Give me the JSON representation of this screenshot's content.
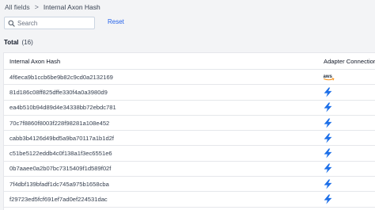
{
  "breadcrumb": {
    "root": "All fields",
    "separator": ">",
    "current": "Internal Axon Hash"
  },
  "toolbar": {
    "search_placeholder": "Search",
    "reset_label": "Reset"
  },
  "total": {
    "label": "Total",
    "count": "(16)"
  },
  "table": {
    "columns": [
      "Internal Axon Hash",
      "Adapter Connections"
    ],
    "rows": [
      {
        "hash": "4f6eca9b1ccb6be9b82c9cd0a2132169",
        "adapter": "aws"
      },
      {
        "hash": "81d186c08ff825dffe330f4a0a3980d9",
        "adapter": "bolt"
      },
      {
        "hash": "ea4b510b94d89d4e34338bb72ebdc781",
        "adapter": "bolt"
      },
      {
        "hash": "70c7f8860f8003f228f98281a108e452",
        "adapter": "bolt"
      },
      {
        "hash": "cabb3b4126d49bd5a9ba70117a1b1d2f",
        "adapter": "bolt"
      },
      {
        "hash": "c51be5122eddb4c0f138a1f3ec6551e6",
        "adapter": "bolt"
      },
      {
        "hash": "0b7aaee0a2b07bc7315409f1d589f02f",
        "adapter": "bolt"
      },
      {
        "hash": "7f4dbf139bfadf1dc745a975b1658cba",
        "adapter": "bolt"
      },
      {
        "hash": "f29723ed5fcf691ef7ad0ef224531dac",
        "adapter": "bolt"
      }
    ]
  },
  "colors": {
    "accent": "#2563eb",
    "bolt": "#1d6fe8",
    "aws_orange": "#f7931e",
    "aws_text": "#232f3e"
  },
  "icons": {
    "search": "search-icon",
    "aws": "aws-logo-icon",
    "bolt": "lightning-bolt-icon"
  }
}
